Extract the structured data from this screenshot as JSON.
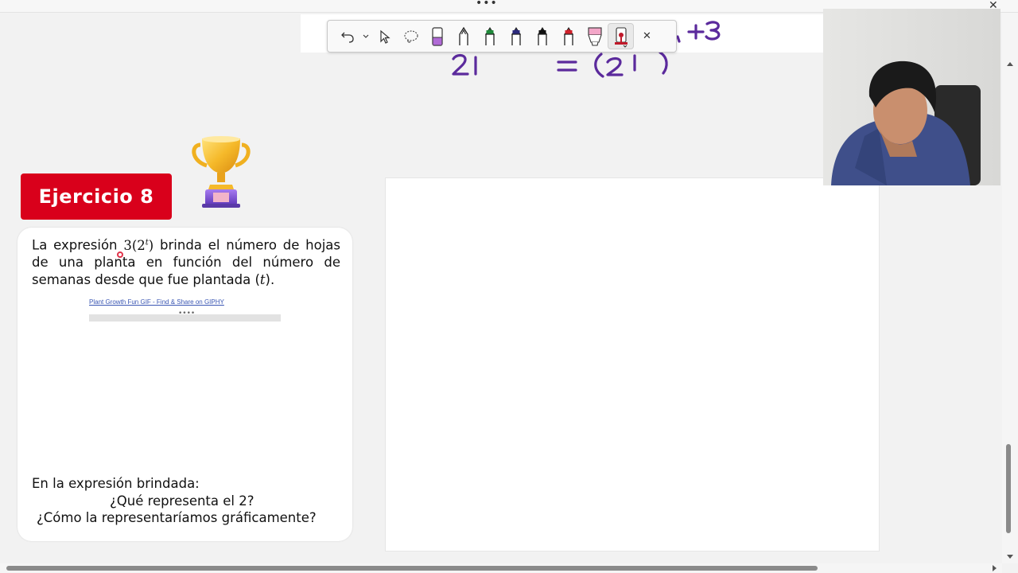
{
  "window": {
    "more_label": "•••",
    "close_label": "✕"
  },
  "toolbar": {
    "tools": [
      {
        "name": "undo",
        "icon": "undo-icon"
      },
      {
        "name": "undo-menu",
        "icon": "chevron-down-icon"
      },
      {
        "name": "select",
        "icon": "select-cursor-icon"
      },
      {
        "name": "lasso",
        "icon": "lasso-icon"
      },
      {
        "name": "eraser",
        "icon": "eraser-icon",
        "color": "#b06ad6"
      },
      {
        "name": "pen-outline",
        "icon": "pen-icon",
        "color": "#ffffff"
      },
      {
        "name": "pen-green",
        "icon": "pen-icon",
        "color": "#1f8a3a"
      },
      {
        "name": "pen-navy",
        "icon": "pen-icon",
        "color": "#2c2a7c"
      },
      {
        "name": "pen-black",
        "icon": "pen-icon",
        "color": "#111111"
      },
      {
        "name": "pen-red",
        "icon": "pen-icon",
        "color": "#d0202a"
      },
      {
        "name": "highlighter-pink",
        "icon": "highlighter-icon",
        "color": "#f3a6c8"
      },
      {
        "name": "ruler-pen",
        "icon": "ruler-pen-icon",
        "color": "#c0192a"
      },
      {
        "name": "close",
        "icon": "close-icon"
      }
    ],
    "close_label": "✕"
  },
  "exercise": {
    "badge": "Ejercicio 8",
    "text_prefix": "La expresión ",
    "math_expr": "3(2",
    "math_sup": "t",
    "math_close": ")",
    "text_body": " brinda el número de hojas de una planta en función del número de semanas desde que fue plantada (",
    "math_t": "t",
    "text_end": ").",
    "gif_link": "Plant Growth Fun GIF - Find & Share on GIPHY",
    "gif_bar_dots": "••••",
    "question_intro": "En la expresión brindada:",
    "question_1": "¿Qué representa el 2?",
    "question_2": "¿Cómo la representaríamos gráficamente?"
  },
  "colors": {
    "badge": "#d9001b",
    "ink": "#5b2a9c",
    "background": "#f2f2f2"
  }
}
